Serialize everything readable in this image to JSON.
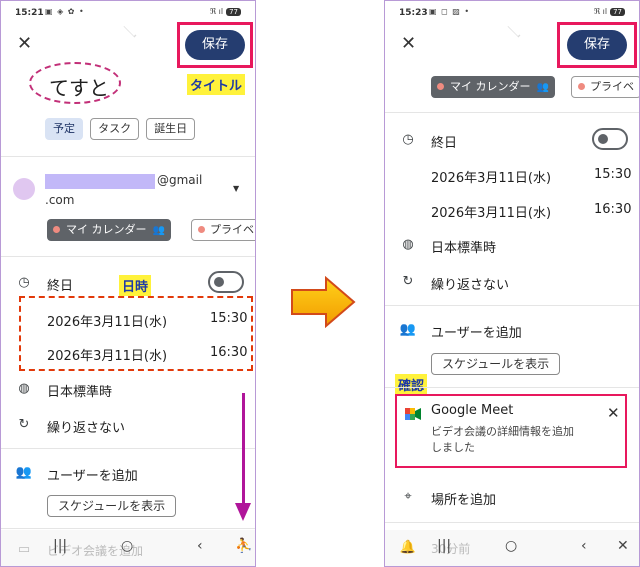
{
  "colors": {
    "save_button": "#253d70",
    "highlight_box": "#e8185d",
    "label_background": "#fff23b",
    "arrow": "#f8b400"
  },
  "left": {
    "status": {
      "time": "15:21",
      "icons": "▣ ◈ ✿ •",
      "right": "ℜ ıl",
      "battery": "77"
    },
    "header": {
      "close_icon": "✕",
      "save_label": "保存"
    },
    "title_value": "てすと",
    "label_title": "タイトル",
    "event_types": [
      "予定",
      "タスク",
      "誕生日"
    ],
    "account": {
      "email_suffix": "@gmail",
      "email_line2": ".com"
    },
    "calendar_chip": "マイ カレンダー",
    "calendar_chip2": "プライベ",
    "all_day_label": "終日",
    "label_datetime": "日時",
    "start": {
      "date": "2026年3月11日(水)",
      "time": "15:30"
    },
    "end": {
      "date": "2026年3月11日(水)",
      "time": "16:30"
    },
    "timezone": "日本標準時",
    "repeat": "繰り返さない",
    "add_users": "ユーザーを追加",
    "schedule_btn": "スケジュールを表示",
    "meet_partial": "ビデオ会議を追加",
    "nav": {
      "recents": "|||",
      "home": "○",
      "back": "‹",
      "a11y": "⛹"
    }
  },
  "right": {
    "status": {
      "time": "15:23",
      "icons": "▣ ◻ ▨ •",
      "right": "ℜ ıl",
      "battery": "77"
    },
    "header": {
      "close_icon": "✕",
      "save_label": "保存"
    },
    "calendar_chip": "マイ カレンダー",
    "calendar_chip2": "プライベ",
    "all_day_label": "終日",
    "start": {
      "date": "2026年3月11日(水)",
      "time": "15:30"
    },
    "end": {
      "date": "2026年3月11日(水)",
      "time": "16:30"
    },
    "timezone": "日本標準時",
    "repeat": "繰り返さない",
    "add_users": "ユーザーを追加",
    "schedule_btn": "スケジュールを表示",
    "label_confirm": "確認",
    "meet": {
      "title": "Google Meet",
      "desc": "ビデオ会議の詳細情報を追加しました",
      "close_icon": "✕"
    },
    "location": "場所を追加",
    "reminder_partial": "30分前",
    "nav": {
      "recents": "|||",
      "home": "○",
      "back": "‹",
      "close": "✕"
    }
  }
}
